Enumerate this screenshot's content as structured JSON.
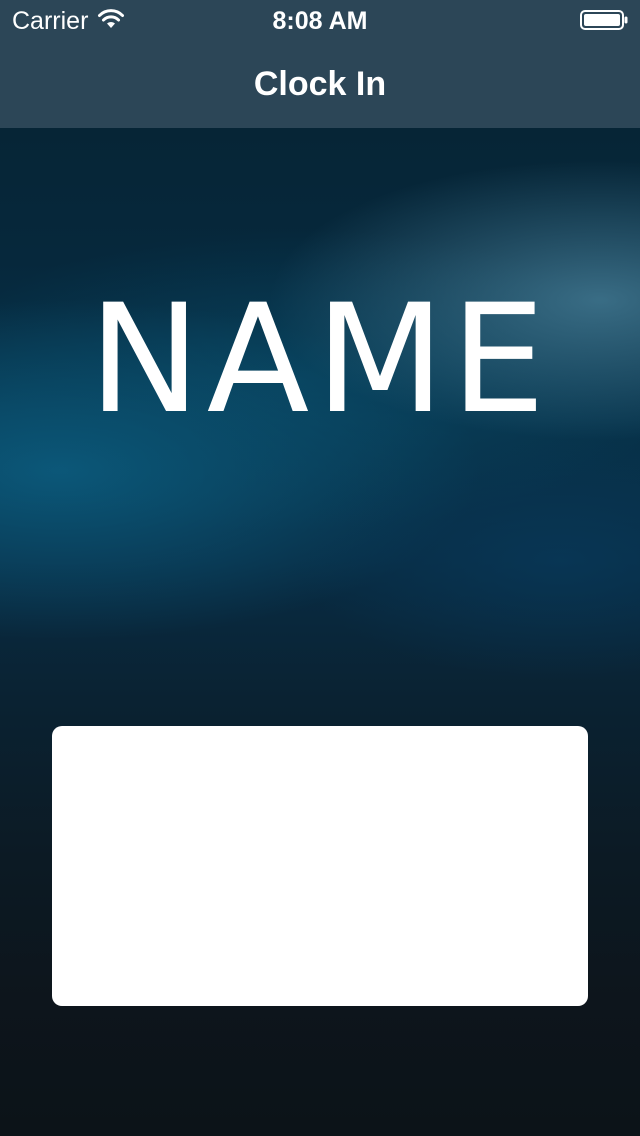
{
  "status_bar": {
    "carrier": "Carrier",
    "time": "8:08 AM",
    "wifi_icon": "wifi-icon",
    "battery_icon": "battery-icon"
  },
  "nav": {
    "title": "Clock In"
  },
  "main": {
    "name": "NAME"
  },
  "colors": {
    "nav_background": "#2c4657",
    "card_background": "#ffffff",
    "text": "#ffffff"
  }
}
